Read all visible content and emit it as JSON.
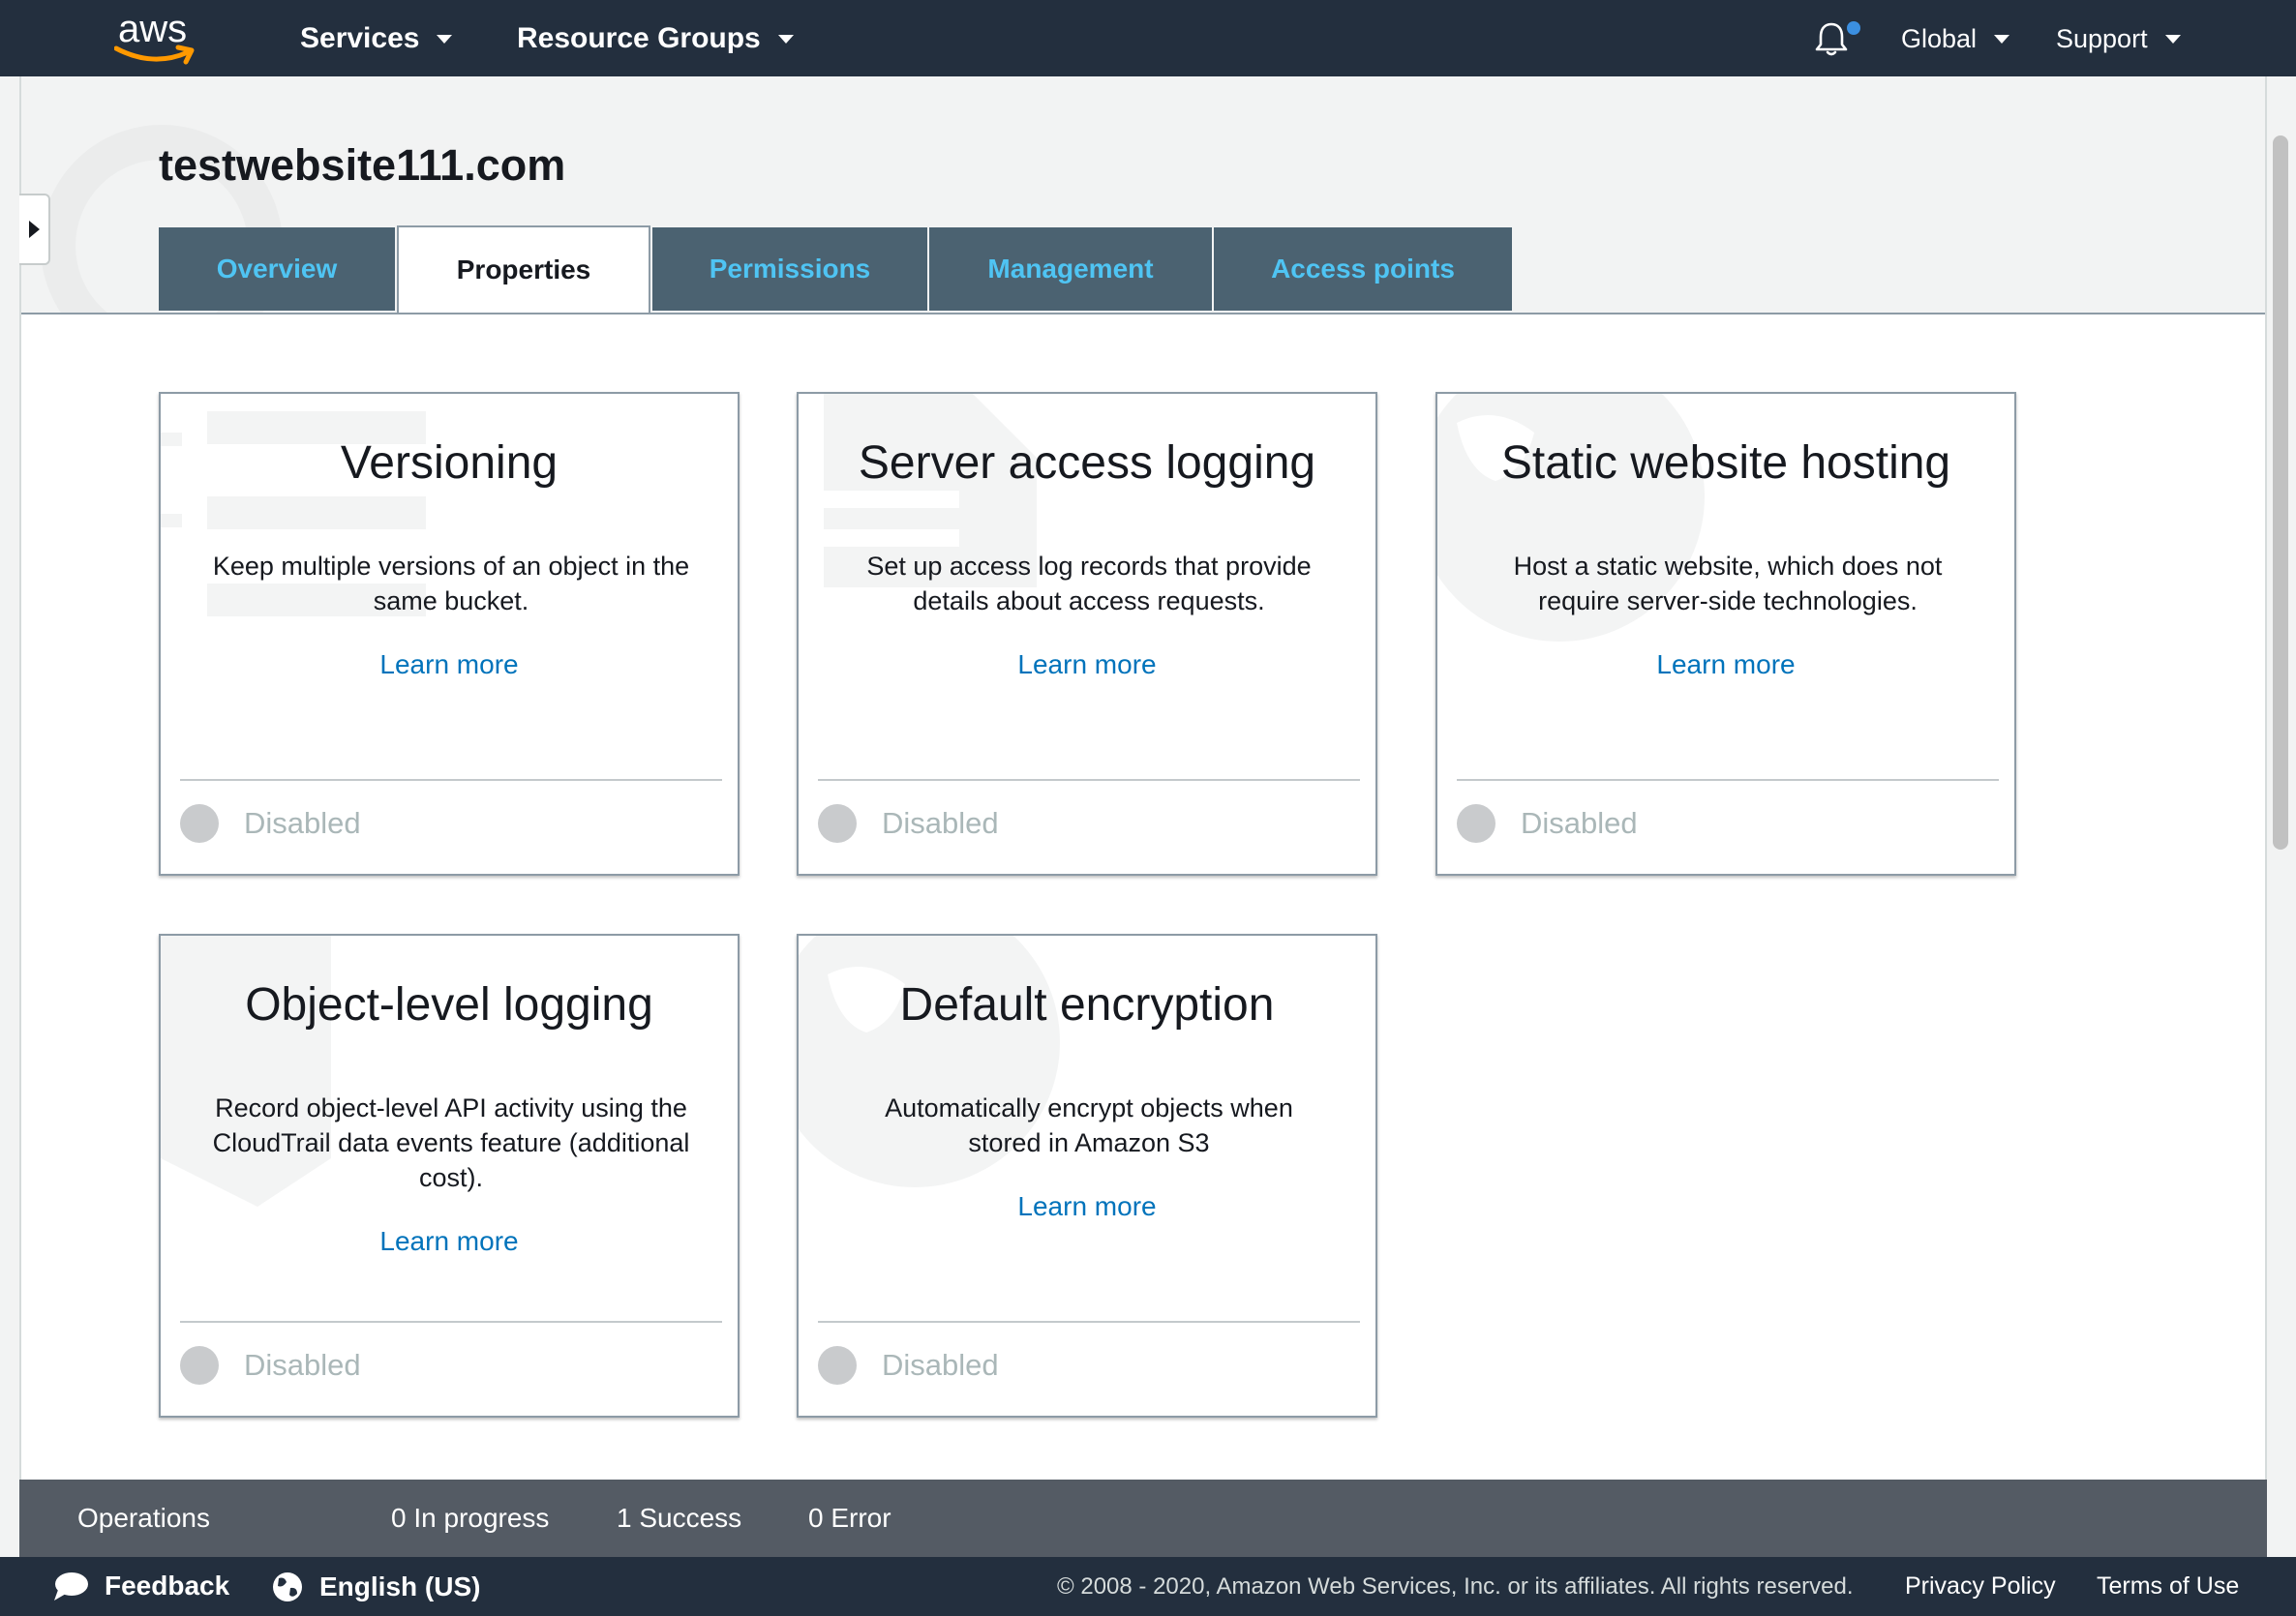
{
  "topnav": {
    "logo_text": "aws",
    "services": "Services",
    "resource_groups": "Resource Groups",
    "notifications_icon": "bell-icon",
    "region": "Global",
    "support": "Support"
  },
  "page": {
    "title": "testwebsite111.com",
    "tabs": [
      {
        "label": "Overview",
        "active": false
      },
      {
        "label": "Properties",
        "active": true
      },
      {
        "label": "Permissions",
        "active": false
      },
      {
        "label": "Management",
        "active": false
      },
      {
        "label": "Access points",
        "active": false
      }
    ]
  },
  "cards": [
    {
      "title": "Versioning",
      "desc": "Keep multiple versions of an object in the same bucket.",
      "link": "Learn more",
      "status": "Disabled"
    },
    {
      "title": "Server access logging",
      "desc": "Set up access log records that provide details about access requests.",
      "link": "Learn more",
      "status": "Disabled"
    },
    {
      "title": "Static website hosting",
      "desc": "Host a static website, which does not require server-side technologies.",
      "link": "Learn more",
      "status": "Disabled"
    },
    {
      "title": "Object-level logging",
      "desc": "Record object-level API activity using the CloudTrail data events feature (additional cost).",
      "link": "Learn more",
      "status": "Disabled"
    },
    {
      "title": "Default encryption",
      "desc": "Automatically encrypt objects when stored in Amazon S3",
      "link": "Learn more",
      "status": "Disabled"
    }
  ],
  "operations": {
    "label": "Operations",
    "in_progress": "0 In progress",
    "success": "1 Success",
    "error": "0 Error"
  },
  "footer": {
    "feedback": "Feedback",
    "language": "English (US)",
    "copyright": "© 2008 - 2020, Amazon Web Services, Inc. or its affiliates. All rights reserved.",
    "privacy": "Privacy Policy",
    "terms": "Terms of Use"
  },
  "colors": {
    "nav_bg": "#232f3e",
    "tab_bg": "#4b6271",
    "tab_text": "#4fc4f3",
    "link": "#0073bb",
    "aws_orange": "#ff9900"
  }
}
